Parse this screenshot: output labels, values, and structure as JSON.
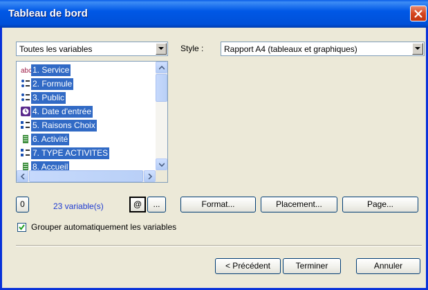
{
  "window": {
    "title": "Tableau de bord"
  },
  "filter": {
    "selected": "Toutes les variables"
  },
  "style": {
    "label": "Style :",
    "selected": "Rapport A4 (tableaux et graphiques)"
  },
  "variables": [
    {
      "label": "1. Service",
      "icon": "text-abc-icon"
    },
    {
      "label": "2. Formule",
      "icon": "single-choice-icon"
    },
    {
      "label": "3. Public",
      "icon": "single-choice-icon"
    },
    {
      "label": "4. Date d'entrée",
      "icon": "date-clock-icon"
    },
    {
      "label": "5. Raisons Choix",
      "icon": "multiple-choice-icon"
    },
    {
      "label": "6. Activité",
      "icon": "numeric-list-icon"
    },
    {
      "label": "7. TYPE ACTIVITES",
      "icon": "multiple-choice-icon"
    },
    {
      "label": "8. Accueil",
      "icon": "numeric-list-icon"
    }
  ],
  "toolbar": {
    "zero_label": "0",
    "count_text": "23 variable(s)",
    "at_label": "@",
    "dots_label": "...",
    "format_label": "Format...",
    "placement_label": "Placement...",
    "page_label": "Page..."
  },
  "group_checkbox": {
    "label": "Grouper automatiquement les variables",
    "checked": true
  },
  "footer": {
    "prev_label": "< Précédent",
    "finish_label": "Terminer",
    "cancel_label": "Annuler"
  },
  "colors": {
    "title_bar": "#0054e3",
    "selection": "#316ac5",
    "link_text": "#1d3ad1",
    "close_button": "#d6461f"
  }
}
